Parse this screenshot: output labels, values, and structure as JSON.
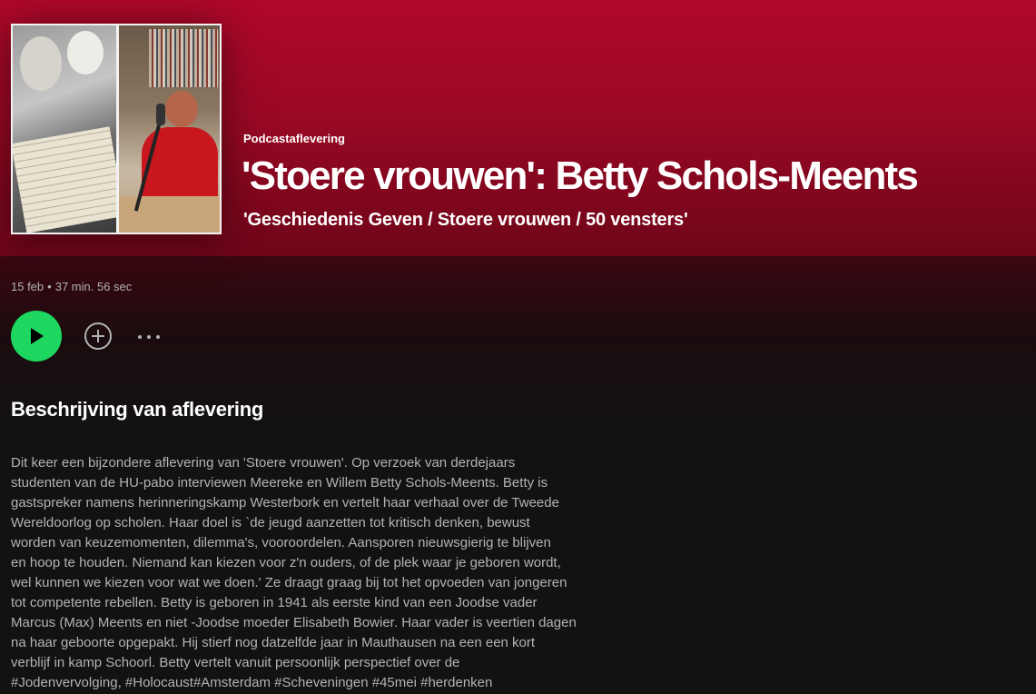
{
  "episode": {
    "type_label": "Podcastaflevering",
    "title": "'Stoere vrouwen': Betty Schols-Meents",
    "show": "'Geschiedenis Geven / Stoere vrouwen / 50 vensters'",
    "date": "15 feb",
    "separator": "•",
    "duration": "37 min. 56 sec"
  },
  "controls": {
    "play_icon": "play-icon",
    "add_icon": "plus-circle-icon",
    "more_icon": "more-options-icon"
  },
  "colors": {
    "header": "#b0082a",
    "play_button": "#1ed760",
    "background": "#121212"
  },
  "description": {
    "heading": "Beschrijving van aflevering",
    "lines": [
      "Dit keer een bijzondere aflevering van 'Stoere vrouwen'. Op verzoek van derdejaars",
      "studenten van de HU-pabo interviewen Meereke en Willem Betty Schols-Meents. Betty is",
      "gastspreker namens herinneringskamp Westerbork en vertelt haar verhaal over de Tweede",
      "Wereldoorlog op scholen. Haar doel is `de jeugd aanzetten tot kritisch denken, bewust",
      "worden van keuzemomenten, dilemma's, vooroordelen. Aansporen nieuwsgierig te blijven",
      "en hoop te houden. Niemand kan kiezen voor z'n ouders, of de plek waar je geboren wordt,",
      "wel kunnen we kiezen voor wat we doen.' Ze draagt graag bij tot het opvoeden van jongeren",
      "tot competente rebellen. Betty is geboren in 1941 als eerste kind van een Joodse vader",
      "Marcus (Max) Meents en niet -Joodse moeder Elisabeth Bowier. Haar vader is veertien dagen",
      "na haar geboorte opgepakt. Hij stierf nog datzelfde jaar in Mauthausen na een een kort",
      "verblijf in kamp Schoorl. Betty vertelt vanuit persoonlijk perspectief over de",
      "#Jodenvervolging, #Holocaust#Amsterdam #Scheveningen #45mei #herdenken"
    ]
  }
}
